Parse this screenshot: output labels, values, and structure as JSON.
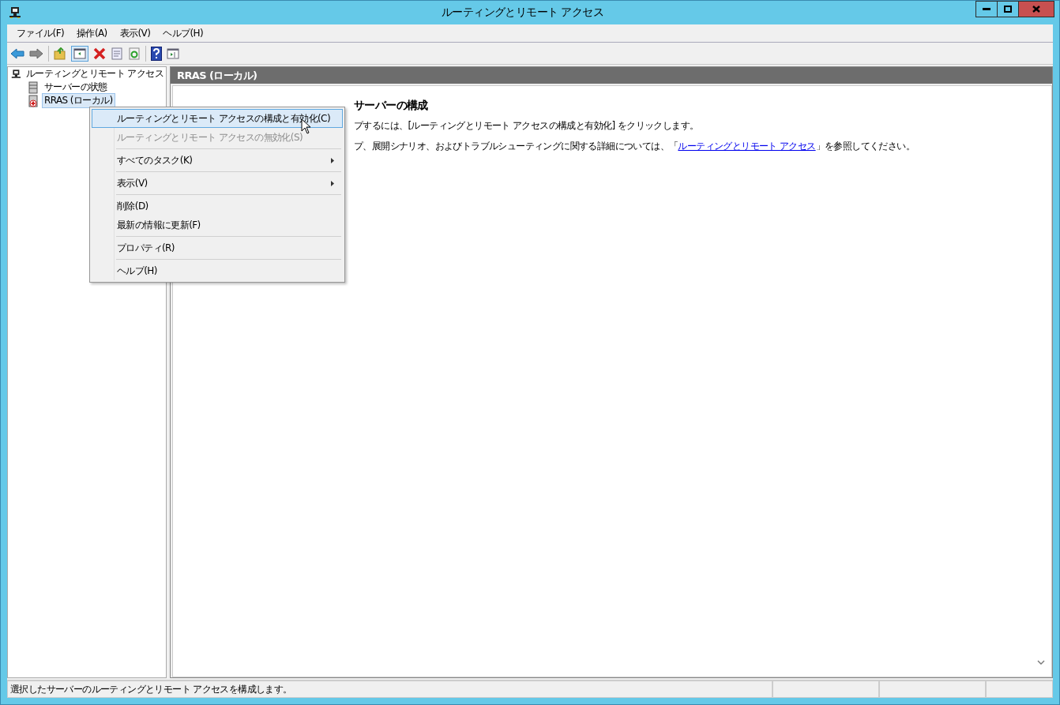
{
  "window": {
    "title": "ルーティングとリモート アクセス"
  },
  "menu_bar": [
    {
      "label": "ファイル(F)"
    },
    {
      "label": "操作(A)"
    },
    {
      "label": "表示(V)"
    },
    {
      "label": "ヘルプ(H)"
    }
  ],
  "tree": [
    {
      "label": "ルーティングとリモート アクセス",
      "selected": false,
      "children": [
        {
          "label": "サーバーの状態",
          "selected": false
        },
        {
          "label": "RRAS (ローカル)",
          "selected": true
        }
      ]
    }
  ],
  "content": {
    "header": "RRAS (ローカル)",
    "heading": "サーバーの構成",
    "line_1": "プするには、[ルーティングとリモート アクセスの構成と有効化] をクリックします。",
    "line_2_before": "プ、展開シナリオ、およびトラブルシューティングに関する詳細については、「",
    "line_2_link": "ルーティングとリモート アクセス",
    "line_2_after": "」を参照してください。"
  },
  "context_menu": [
    {
      "kind": "item",
      "label": "ルーティングとリモート アクセスの構成と有効化(C)",
      "selected": true,
      "disabled": false,
      "submenu": false
    },
    {
      "kind": "item",
      "label": "ルーティングとリモート アクセスの無効化(S)",
      "selected": false,
      "disabled": true,
      "submenu": false
    },
    {
      "kind": "separator"
    },
    {
      "kind": "item",
      "label": "すべてのタスク(K)",
      "selected": false,
      "disabled": false,
      "submenu": true
    },
    {
      "kind": "separator"
    },
    {
      "kind": "item",
      "label": "表示(V)",
      "selected": false,
      "disabled": false,
      "submenu": true
    },
    {
      "kind": "separator"
    },
    {
      "kind": "item",
      "label": "削除(D)",
      "selected": false,
      "disabled": false,
      "submenu": false
    },
    {
      "kind": "item",
      "label": "最新の情報に更新(F)",
      "selected": false,
      "disabled": false,
      "submenu": false
    },
    {
      "kind": "separator"
    },
    {
      "kind": "item",
      "label": "プロパティ(R)",
      "selected": false,
      "disabled": false,
      "submenu": false
    },
    {
      "kind": "separator"
    },
    {
      "kind": "item",
      "label": "ヘルプ(H)",
      "selected": false,
      "disabled": false,
      "submenu": false
    }
  ],
  "status_bar": {
    "text": "選択したサーバーのルーティングとリモート アクセスを構成します。"
  }
}
